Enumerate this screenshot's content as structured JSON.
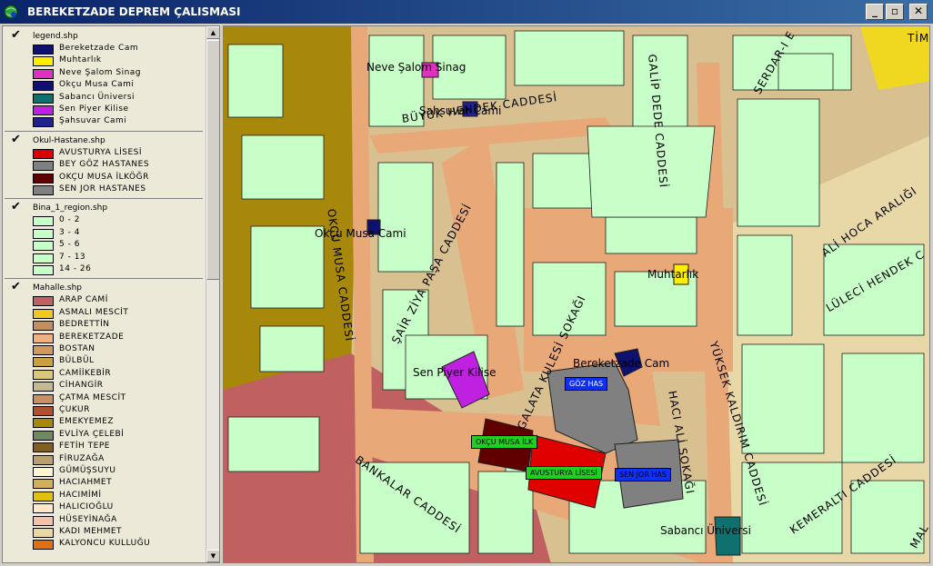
{
  "window": {
    "title": "BEREKETZADE DEPREM ÇALISMASI",
    "icon": "globe-map-icon",
    "buttons": {
      "minimize": "_",
      "maximize": "▫",
      "close": "✕"
    }
  },
  "toc": {
    "layers": [
      {
        "name": "legend.shp",
        "checked": true,
        "items": [
          {
            "label": "Bereketzade  Cam",
            "color": "#10106e"
          },
          {
            "label": "Muhtarlık",
            "color": "#ffee00"
          },
          {
            "label": "Neve Şalom Sinag",
            "color": "#e030c0"
          },
          {
            "label": "Okçu Musa Cami",
            "color": "#101070"
          },
          {
            "label": "Sabancı Üniversi",
            "color": "#107070"
          },
          {
            "label": "Sen Piyer Kilise",
            "color": "#c020e0"
          },
          {
            "label": "Şahsuvar Cami",
            "color": "#202090"
          }
        ]
      },
      {
        "name": "Okul-Hastane.shp",
        "checked": true,
        "items": [
          {
            "label": "AVUSTURYA LİSESİ",
            "color": "#e00000"
          },
          {
            "label": "BEY GÖZ HASTANES",
            "color": "#808080"
          },
          {
            "label": "OKÇU MUSA İLKÖĞR",
            "color": "#600000"
          },
          {
            "label": "SEN JOR HASTANES",
            "color": "#808080"
          }
        ]
      },
      {
        "name": "Bina_1_region.shp",
        "checked": true,
        "items": [
          {
            "label": "0 - 2",
            "color": "#c8ffc8"
          },
          {
            "label": "3 - 4",
            "color": "#c8ffc8"
          },
          {
            "label": "5 - 6",
            "color": "#c8ffc8"
          },
          {
            "label": "7 - 13",
            "color": "#c8ffc8"
          },
          {
            "label": "14 - 26",
            "color": "#c8ffc8"
          }
        ]
      },
      {
        "name": "Mahalle.shp",
        "checked": true,
        "items": [
          {
            "label": "ARAP CAMİ",
            "color": "#c06060"
          },
          {
            "label": "ASMALI MESCİT",
            "color": "#f0c820"
          },
          {
            "label": "BEDRETTİN",
            "color": "#c09060"
          },
          {
            "label": "BEREKETZADE",
            "color": "#f0b080"
          },
          {
            "label": "BOSTAN",
            "color": "#d09860"
          },
          {
            "label": "BÜLBÜL",
            "color": "#c8a040"
          },
          {
            "label": "CAMİİKEBİR",
            "color": "#d8c878"
          },
          {
            "label": "CİHANGİR",
            "color": "#c8b890"
          },
          {
            "label": "ÇATMA MESCİT",
            "color": "#c89060"
          },
          {
            "label": "ÇUKUR",
            "color": "#b05030"
          },
          {
            "label": "EMEKYEMEZ",
            "color": "#a8880a"
          },
          {
            "label": "EVLİYA ÇELEBİ",
            "color": "#708860"
          },
          {
            "label": "FETİH TEPE",
            "color": "#806020"
          },
          {
            "label": "FİRUZAĞA",
            "color": "#b8a070"
          },
          {
            "label": "GÜMÜŞSUYU",
            "color": "#fff4d0"
          },
          {
            "label": "HACIAHMET",
            "color": "#d0b060"
          },
          {
            "label": "HACIMİMİ",
            "color": "#e0c010"
          },
          {
            "label": "HALICIOĞLU",
            "color": "#ffe8c8"
          },
          {
            "label": "HÜSEYİNAĞA",
            "color": "#f8c0a8"
          },
          {
            "label": "KADI MEHMET",
            "color": "#e8d8a8"
          },
          {
            "label": "KALYONCU KULLUĞU",
            "color": "#e07010"
          }
        ]
      }
    ],
    "scroll_up": "▲",
    "scroll_down": "▼"
  },
  "map": {
    "colors": {
      "building": "#c8ffc8",
      "street": "#e8a878",
      "district": "#d8c090",
      "ochre": "#a8880a",
      "red_district": "#c06060",
      "yellow_district": "#f0d820",
      "outline": "#202020"
    },
    "place_labels": [
      {
        "key": "neve",
        "text": "Neve Şalom Sinag"
      },
      {
        "key": "sahsuvar",
        "text": "Şahsuvar Cami"
      },
      {
        "key": "okcu",
        "text": "Okçu Musa Cami"
      },
      {
        "key": "muhtar",
        "text": "Muhtarlık"
      },
      {
        "key": "senpiyer",
        "text": "Sen Piyer Kilise"
      },
      {
        "key": "bereket",
        "text": "Bereketzade Cam"
      },
      {
        "key": "sabanci",
        "text": "Sabancı Üniversi"
      }
    ],
    "street_labels": [
      {
        "key": "buyukhendek",
        "text": "BÜYÜK HENDEK CADDESİ"
      },
      {
        "key": "sairziya",
        "text": "ŞAİR ZİYA PAŞA CADDESİ"
      },
      {
        "key": "okcucad",
        "text": "OKÇU MUSA CADDESİ"
      },
      {
        "key": "galata",
        "text": "GALATA KULESİ SOKAĞI"
      },
      {
        "key": "bankalar",
        "text": "BANKALAR CADDESİ"
      },
      {
        "key": "yuksekkaldirim",
        "text": "YÜKSEK KALDIRIM CADDESİ"
      },
      {
        "key": "kemeralti",
        "text": "KEMERALTI CADDESİ"
      },
      {
        "key": "lulecihendek",
        "text": "LÜLECİ HENDEK C"
      },
      {
        "key": "alihoca",
        "text": "ALİ HOCA ARALIĞI"
      },
      {
        "key": "galipdede",
        "text": "GALİP DEDE CADDESİ"
      },
      {
        "key": "serdari",
        "text": "SERDAR-I E"
      },
      {
        "key": "hacisokak",
        "text": "HACI ALİ SOKAĞI"
      },
      {
        "key": "tim",
        "text": "TİM"
      },
      {
        "key": "mal",
        "text": "MAL"
      }
    ],
    "box_labels": [
      {
        "key": "gozhas",
        "text": "GÖZ HAS",
        "bg": "#1030f0",
        "fg": "#ffffff"
      },
      {
        "key": "okcuilk",
        "text": "OKÇU MUSA İLK",
        "bg": "#20d020",
        "fg": "#000000"
      },
      {
        "key": "avusturya",
        "text": "AVUSTURYA LİSESİ",
        "bg": "#20d020",
        "fg": "#000000"
      },
      {
        "key": "senjor",
        "text": "SEN JOR HAS",
        "bg": "#1030f0",
        "fg": "#000000"
      }
    ]
  }
}
